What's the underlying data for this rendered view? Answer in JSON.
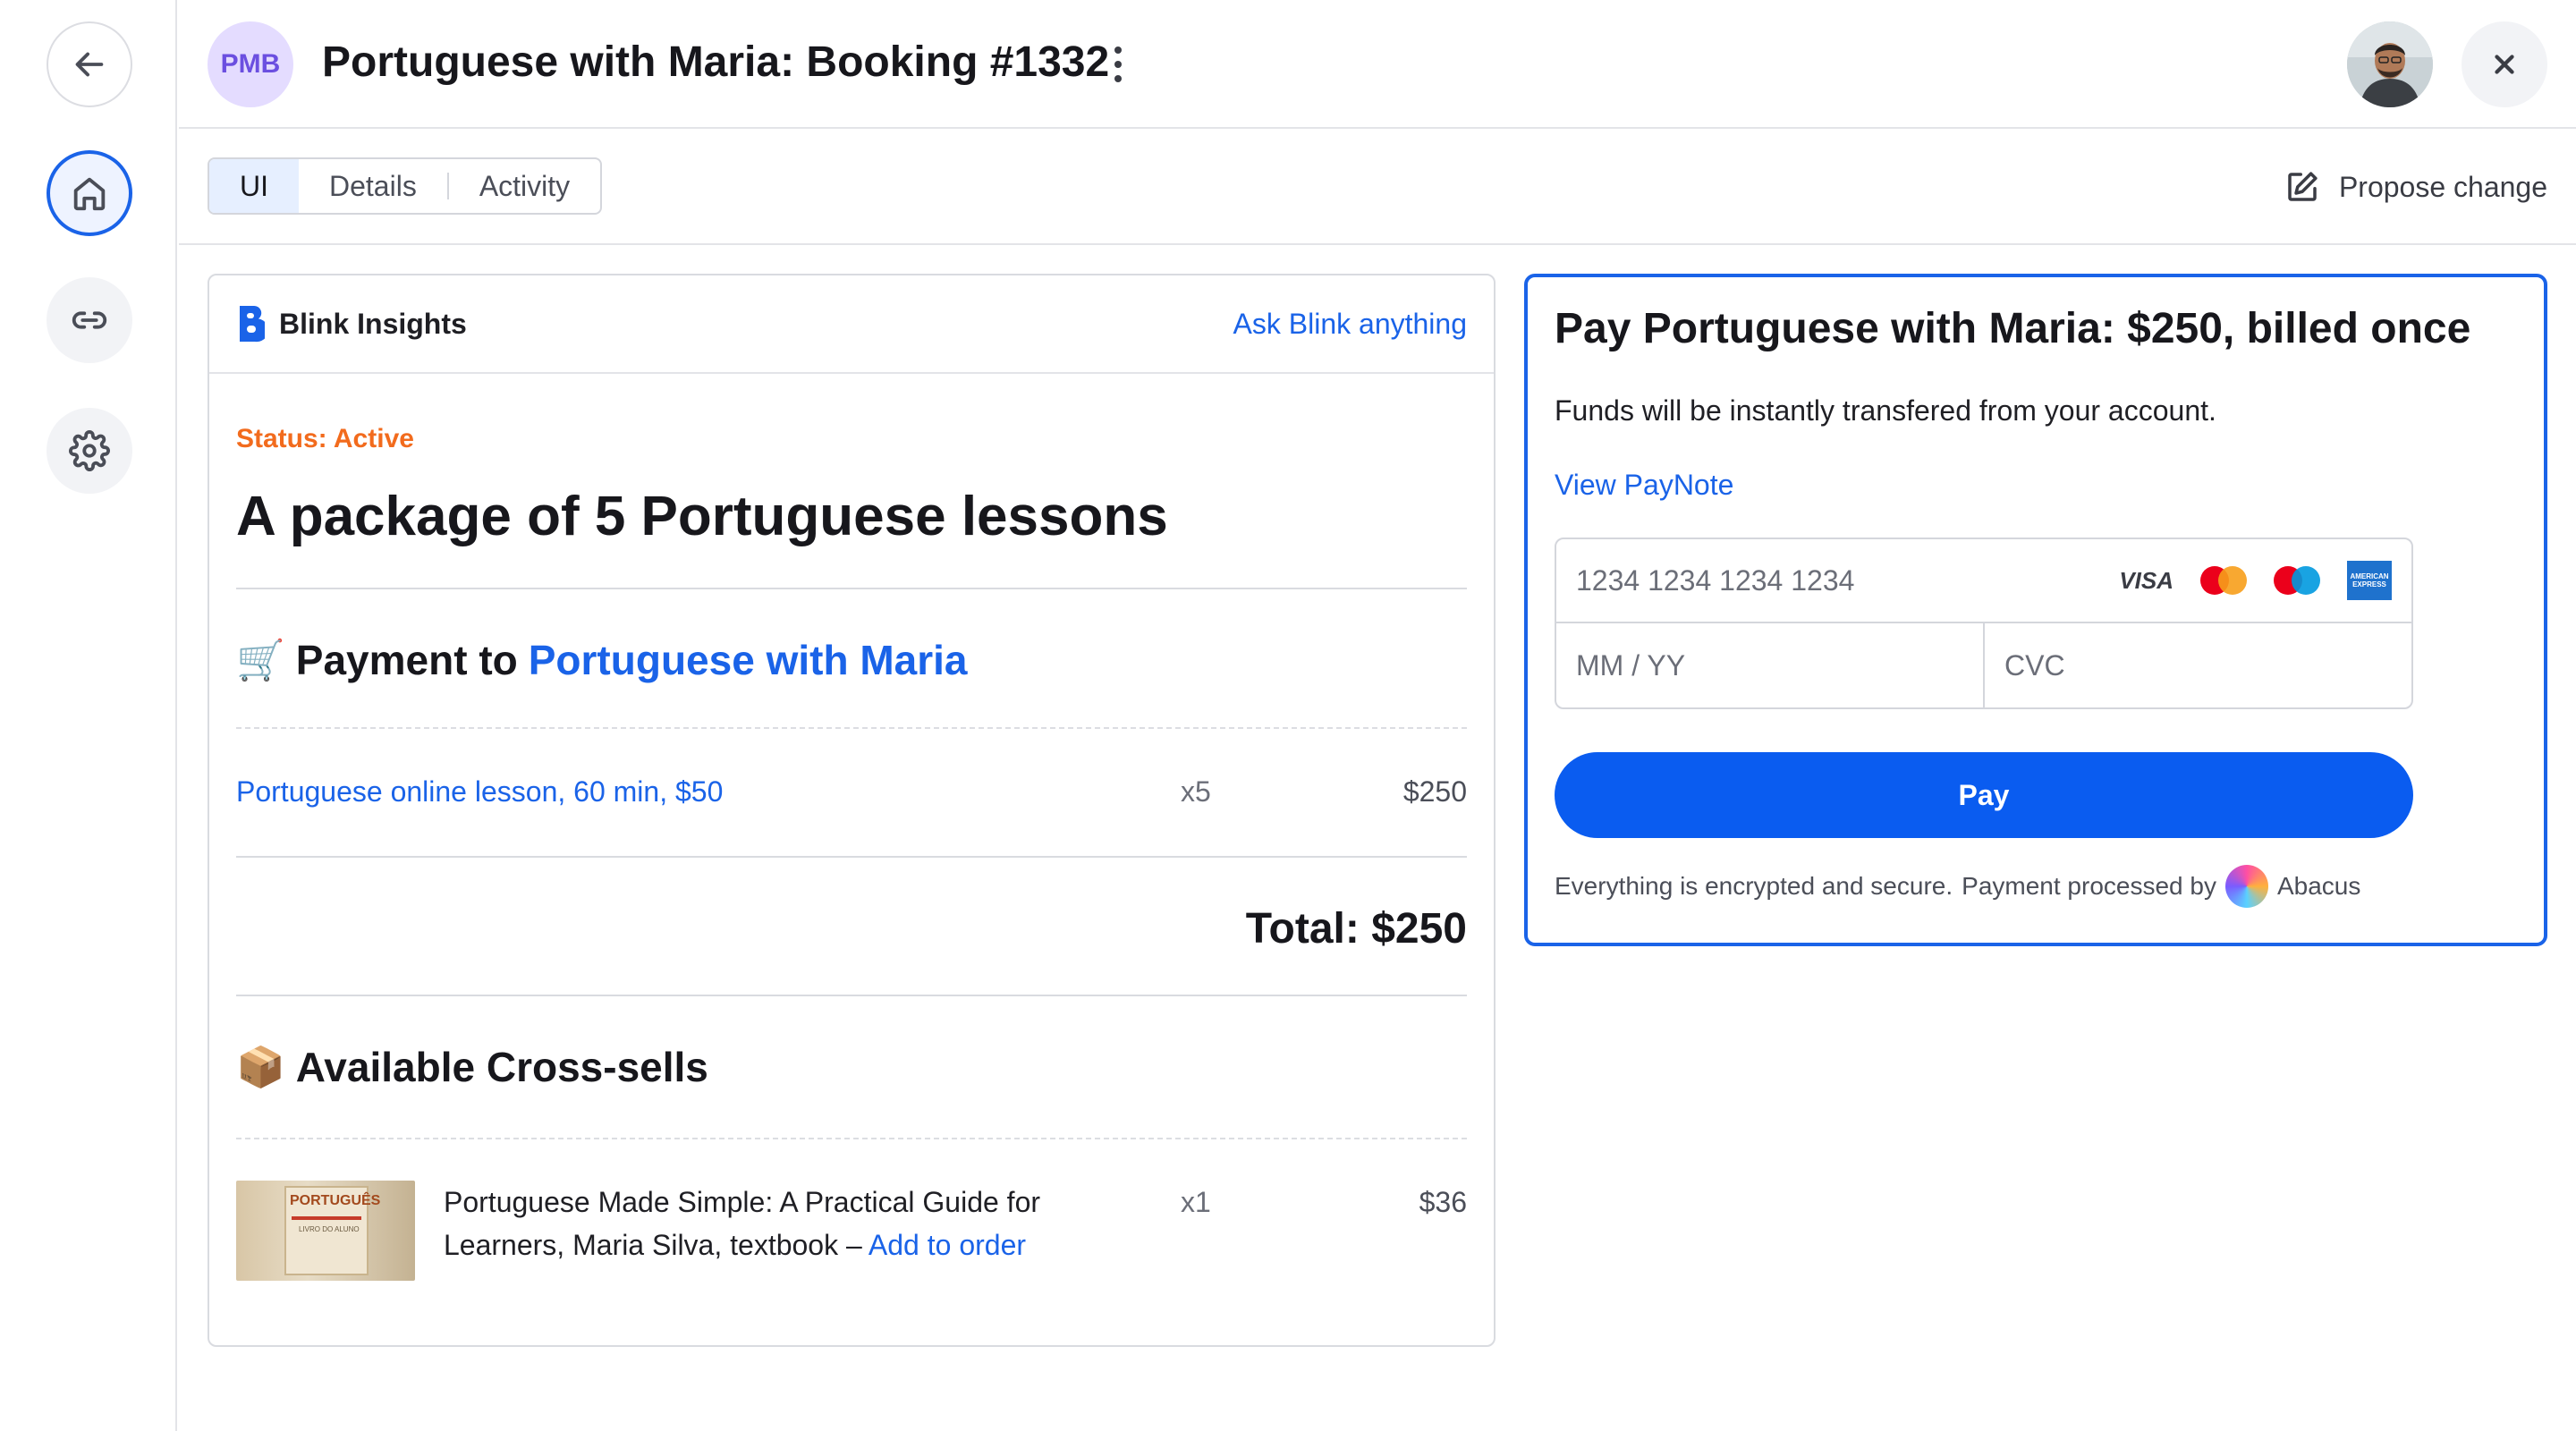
{
  "header": {
    "badge": "PMB",
    "title": "Portuguese with Maria: Booking #1332"
  },
  "tabs": [
    {
      "label": "UI",
      "active": true
    },
    {
      "label": "Details",
      "active": false
    },
    {
      "label": "Activity",
      "active": false
    }
  ],
  "propose_change": "Propose change",
  "insights": {
    "brand": "Blink Insights",
    "ask_link": "Ask Blink anything",
    "status": "Status: Active",
    "package_title": "A package of 5 Portuguese lessons",
    "payment_prefix": "Payment to",
    "payment_recipient": "Portuguese with Maria",
    "payment_emoji": "🛒",
    "line_item": {
      "description": "Portuguese online lesson, 60 min, $50",
      "qty": "x5",
      "amount": "$250"
    },
    "total": "Total: $250",
    "crosssell_title": "Available Cross-sells",
    "crosssell_emoji": "📦",
    "crosssell_item": {
      "description": "Portuguese Made Simple: A Practical Guide for Learners, Maria Silva, textbook –",
      "add_link": "Add to order",
      "qty": "x1",
      "amount": "$36",
      "cover_title": "PORTUGUÊS",
      "cover_subtitle": "LIVRO DO ALUNO"
    }
  },
  "payment": {
    "title": "Pay Portuguese with Maria: $250, billed once",
    "note": "Funds will be instantly transfered from your account.",
    "paynote_link": "View PayNote",
    "card_number_placeholder": "1234 1234 1234 1234",
    "expiry_placeholder": "MM / YY",
    "cvc_placeholder": "CVC",
    "brands": [
      "VISA",
      "mastercard",
      "maestro",
      "AMERICAN EXPRESS"
    ],
    "pay_button": "Pay",
    "secure_text": "Everything is encrypted and secure.",
    "processed_by": "Payment processed by",
    "processor": "Abacus"
  },
  "colors": {
    "accent": "#1a63e8",
    "status": "#f26b1d",
    "pay_button": "#0a5cf0"
  }
}
